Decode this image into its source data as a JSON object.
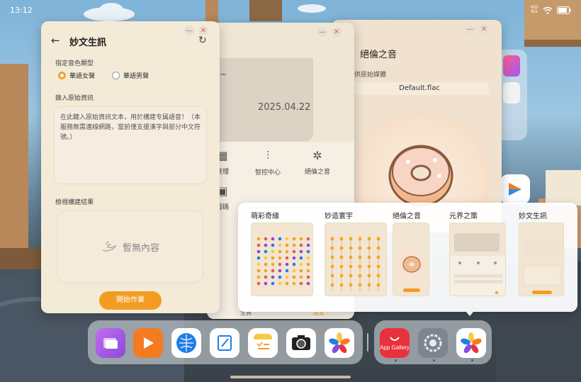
{
  "status": {
    "time": "13:12",
    "net_speed_value": "455",
    "net_speed_unit": "B/s"
  },
  "main_window": {
    "title": "妙文生訊",
    "voice_type_label": "指定音色類型",
    "voice_options": [
      "華語女聲",
      "華語男聲"
    ],
    "selected_voice": "華語女聲",
    "input_label": "錄入原始資訊",
    "input_placeholder": "在此鍵入原始資訊文本，用於構建专属語音！（本服務無需連線網路，當前僅支援漢字與部分中文符號。）",
    "result_label": "檢視構建結果",
    "empty_text": "暫無內容",
    "start_button": "開始作業"
  },
  "bg_window_1": {
    "note_tilde": "~",
    "date": "2025.04.22",
    "func_labels": [
      "管理",
      "智控中心",
      "絕倫之音"
    ],
    "func_icons": [
      "manage-icon",
      "sliders-icon",
      "music-puzzle-icon"
    ],
    "partial_label": "圖碼",
    "bottom_partial_left": "詳",
    "bottom_partial_mid": "主頁",
    "bottom_partial_right": "設定"
  },
  "bg_window_2": {
    "title": "絕倫之音",
    "source_label": "供原始媒體",
    "file_name": "Default.flac"
  },
  "switcher": {
    "apps": [
      "萌彩奇緣",
      "妙造寰宇",
      "絕倫之音",
      "元界之策",
      "妙文生訊"
    ]
  },
  "dock": {
    "apps": [
      {
        "name": "multi-window",
        "color": "#9b59d8"
      },
      {
        "name": "video",
        "color": "#f47b20"
      },
      {
        "name": "browser",
        "color": "#1f7ee8"
      },
      {
        "name": "notes-pen",
        "color": "#ffffff"
      },
      {
        "name": "notepad",
        "color": "#f7c948"
      },
      {
        "name": "camera",
        "color": "#ffffff"
      },
      {
        "name": "gallery",
        "color": "#ffffff"
      }
    ],
    "recent_apps": [
      {
        "name": "appgallery",
        "label": "App Gallery",
        "color": "#e8313b"
      },
      {
        "name": "settings",
        "color": "#7d8690"
      },
      {
        "name": "gallery",
        "color": "#ffffff"
      }
    ]
  },
  "colors": {
    "accent": "#f39c22",
    "window_bg": "#f4ead8",
    "close": "#e85a50"
  }
}
